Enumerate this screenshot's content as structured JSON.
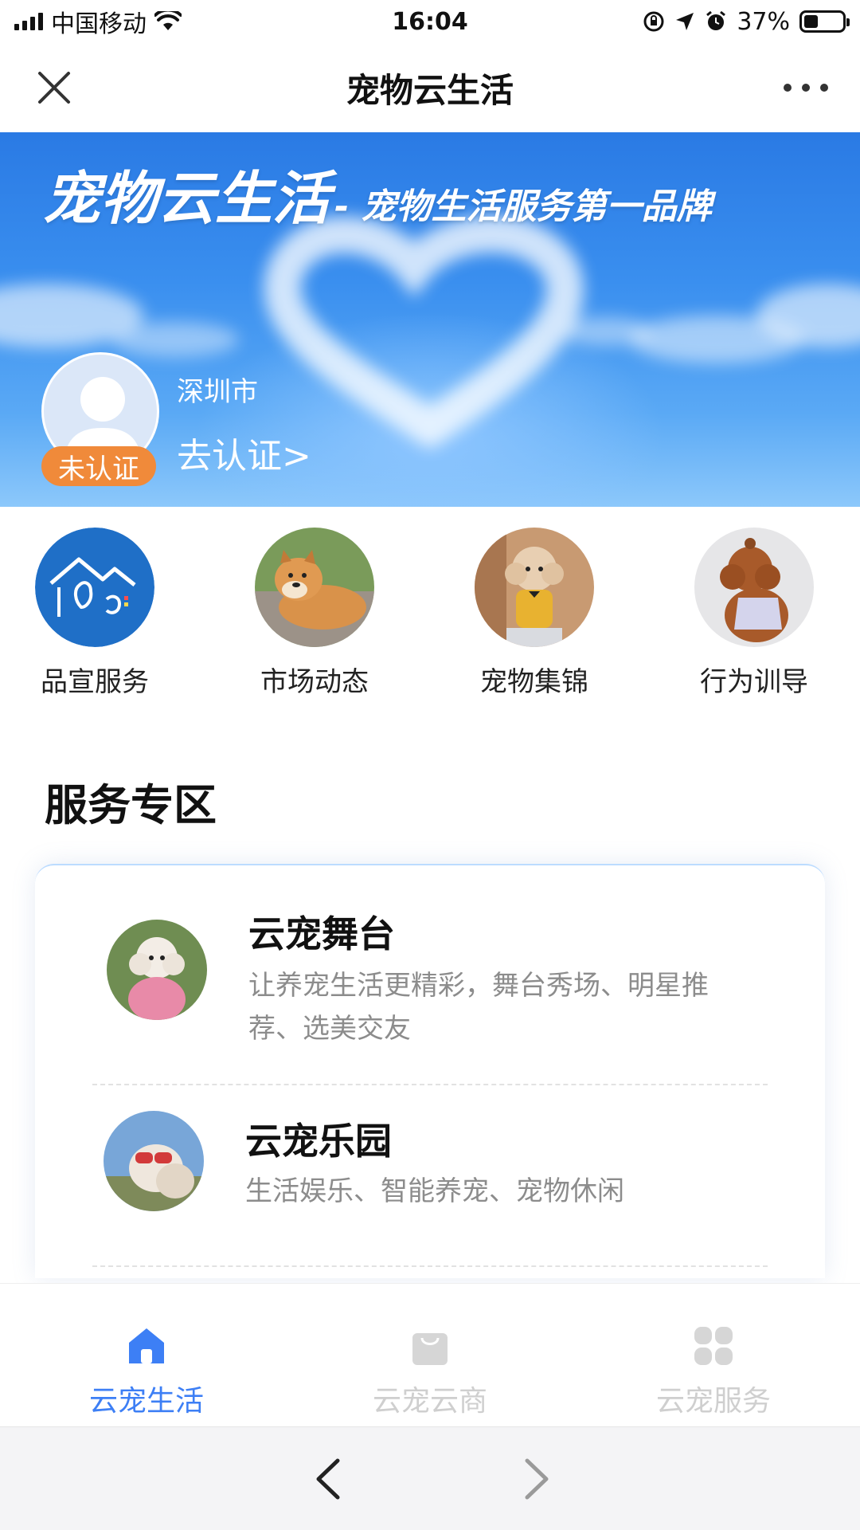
{
  "status_bar": {
    "carrier": "中国移动",
    "time": "16:04",
    "battery": "37%",
    "battery_level": 0.37
  },
  "nav": {
    "title": "宠物云生活"
  },
  "banner": {
    "title": "宠物云生活",
    "subtitle": "- 宠物生活服务第一品牌",
    "city": "深圳市",
    "verify_link": "去认证>",
    "badge": "未认证"
  },
  "quick_menu": [
    {
      "label": "品宣服务"
    },
    {
      "label": "市场动态"
    },
    {
      "label": "宠物集锦"
    },
    {
      "label": "行为训导"
    }
  ],
  "section": {
    "title": "服务专区"
  },
  "services": [
    {
      "name": "云宠舞台",
      "desc": "让养宠生活更精彩，舞台秀场、明星推荐、选美交友"
    },
    {
      "name": "云宠乐园",
      "desc": "生活娱乐、智能养宠、宠物休闲"
    }
  ],
  "tab_bar": {
    "tabs": [
      {
        "label": "云宠生活",
        "active": true
      },
      {
        "label": "云宠云商",
        "active": false
      },
      {
        "label": "云宠服务",
        "active": false
      }
    ],
    "active_color": "#3d7ff5",
    "inactive_color": "#cfcfcf"
  },
  "colors": {
    "badge": "#f08a3a",
    "banner_sky": "#2a7ae4"
  }
}
